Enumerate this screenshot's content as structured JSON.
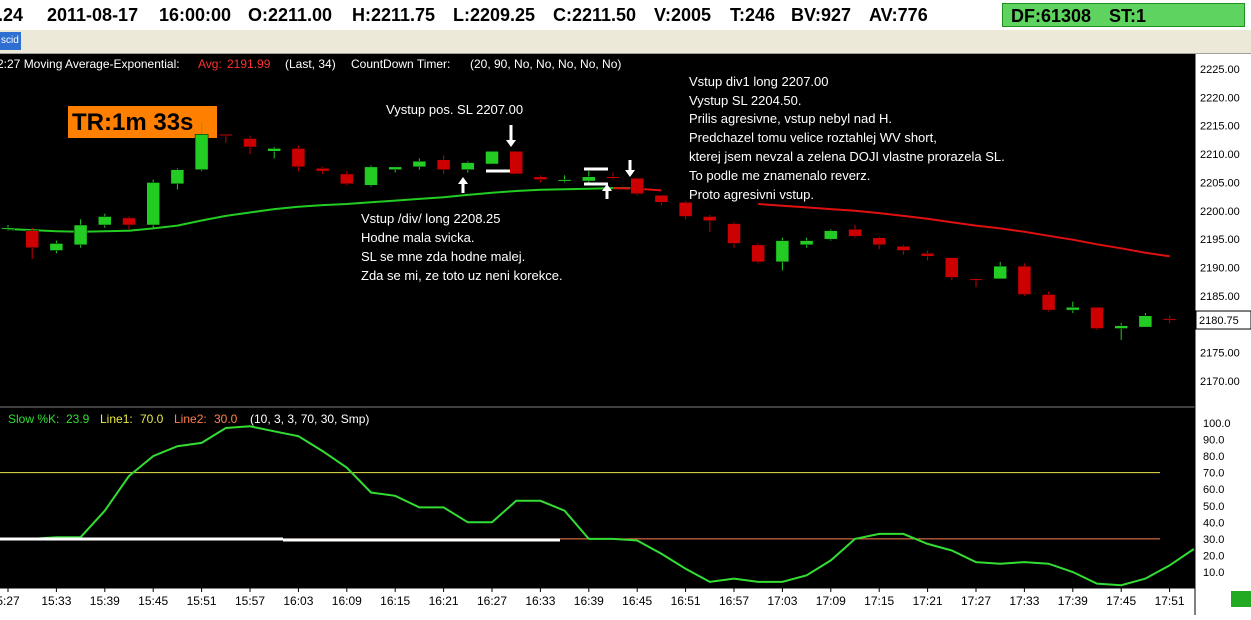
{
  "quote_bar": {
    "partial_field": ".24",
    "date": "2011-08-17",
    "time": "16:00:00",
    "open": "O:2211.00",
    "high": "H:2211.75",
    "low": "L:2209.25",
    "close": "C:2211.50",
    "volume": "V:2005",
    "ticks": "T:246",
    "bid_volume": "BV:927",
    "ask_volume": "AV:776",
    "df": "DF:61308",
    "st": "ST:1"
  },
  "tab": {
    "label": "scid"
  },
  "colors": {
    "bull": "#22cc22",
    "bear": "#cc0000",
    "ma": "#22cc22",
    "ma_bear": "#e01010",
    "stoch": "#33dd33",
    "line1": "#e8e84a",
    "line2": "#ff7f50",
    "background": "#000000",
    "timer_bg": "#ff7f00"
  },
  "price_header": {
    "prefix": "2:27 Moving Average-Exponential:",
    "avg_label": "Avg:",
    "avg_value": "2191.99",
    "params": "(Last, 34)",
    "countdown_label": "CountDown Timer:",
    "countdown_params": "(20, 90, No, No, No, No, No)"
  },
  "timer_badge": "TR:1m 33s",
  "annotations": {
    "exit_pos": "Vystup pos. SL 2207.00",
    "entry_div": [
      "Vstup /div/ long 2208.25",
      "Hodne mala svicka.",
      "SL se mne zda hodne malej.",
      "Zda se mi, ze toto uz neni korekce."
    ],
    "entry_div1": [
      "Vstup div1 long 2207.00",
      "Vystup SL 2204.50.",
      "Prilis agresivne, vstup nebyl nad H.",
      "Predchazel tomu velice roztahlej WV short,",
      "kterej jsem nevzal a zelena DOJI vlastne prorazela SL.",
      "To podle me znamenalo reverz.",
      "Proto agresivni vstup."
    ]
  },
  "stoch_header": {
    "k_label": "Slow %K:",
    "k_value": "23.9",
    "line1_label": "Line1:",
    "line1_value": "70.0",
    "line2_label": "Line2:",
    "line2_value": "30.0",
    "params": "(10, 3, 3, 70, 30, Smp)"
  },
  "chart_data": [
    {
      "type": "candlestick",
      "title": "",
      "ylim": [
        2167,
        2227
      ],
      "y_ticks": [
        "2225.00",
        "2220.00",
        "2215.00",
        "2210.00",
        "2205.00",
        "2200.00",
        "2195.00",
        "2190.00",
        "2185.00",
        "2180.00",
        "2175.00",
        "2170.00"
      ],
      "last_price_label": "2180.75",
      "candles": [
        {
          "o": 2197.0,
          "h": 2197.5,
          "l": 2196.5,
          "c": 2197.0
        },
        {
          "o": 2196.5,
          "h": 2197.0,
          "l": 2191.5,
          "c": 2193.5
        },
        {
          "o": 2193.0,
          "h": 2194.75,
          "l": 2192.5,
          "c": 2194.25
        },
        {
          "o": 2194.0,
          "h": 2198.5,
          "l": 2193.5,
          "c": 2197.5
        },
        {
          "o": 2197.5,
          "h": 2199.5,
          "l": 2197.0,
          "c": 2199.0
        },
        {
          "o": 2198.75,
          "h": 2199.0,
          "l": 2196.75,
          "c": 2197.5
        },
        {
          "o": 2197.5,
          "h": 2205.5,
          "l": 2196.75,
          "c": 2205.0
        },
        {
          "o": 2204.75,
          "h": 2207.5,
          "l": 2203.75,
          "c": 2207.25
        },
        {
          "o": 2207.25,
          "h": 2215.5,
          "l": 2207.0,
          "c": 2213.5
        },
        {
          "o": 2213.5,
          "h": 2213.5,
          "l": 2212.0,
          "c": 2213.25
        },
        {
          "o": 2212.75,
          "h": 2213.25,
          "l": 2210.0,
          "c": 2211.25
        },
        {
          "o": 2210.5,
          "h": 2211.25,
          "l": 2209.25,
          "c": 2211.0
        },
        {
          "o": 2211.0,
          "h": 2211.5,
          "l": 2207.0,
          "c": 2207.75
        },
        {
          "o": 2207.5,
          "h": 2207.75,
          "l": 2206.5,
          "c": 2207.0
        },
        {
          "o": 2206.5,
          "h": 2207.0,
          "l": 2204.5,
          "c": 2204.75
        },
        {
          "o": 2204.5,
          "h": 2208.0,
          "l": 2204.25,
          "c": 2207.75
        },
        {
          "o": 2207.25,
          "h": 2207.75,
          "l": 2206.75,
          "c": 2207.75
        },
        {
          "o": 2207.75,
          "h": 2209.25,
          "l": 2207.25,
          "c": 2208.75
        },
        {
          "o": 2209.0,
          "h": 2209.75,
          "l": 2206.5,
          "c": 2207.25
        },
        {
          "o": 2207.25,
          "h": 2208.75,
          "l": 2206.75,
          "c": 2208.5
        },
        {
          "o": 2208.25,
          "h": 2210.5,
          "l": 2208.25,
          "c": 2210.5
        },
        {
          "o": 2210.5,
          "h": 2210.5,
          "l": 2206.5,
          "c": 2206.5
        },
        {
          "o": 2206.0,
          "h": 2206.25,
          "l": 2205.0,
          "c": 2205.5
        },
        {
          "o": 2205.5,
          "h": 2206.25,
          "l": 2205.0,
          "c": 2205.5
        },
        {
          "o": 2205.25,
          "h": 2207.0,
          "l": 2204.5,
          "c": 2206.0
        },
        {
          "o": 2206.0,
          "h": 2206.75,
          "l": 2205.5,
          "c": 2205.75
        },
        {
          "o": 2205.75,
          "h": 2205.75,
          "l": 2202.75,
          "c": 2203.0
        },
        {
          "o": 2202.75,
          "h": 2202.75,
          "l": 2201.0,
          "c": 2201.5
        },
        {
          "o": 2201.5,
          "h": 2201.75,
          "l": 2198.5,
          "c": 2199.0
        },
        {
          "o": 2199.0,
          "h": 2199.25,
          "l": 2196.25,
          "c": 2198.25
        },
        {
          "o": 2197.75,
          "h": 2198.0,
          "l": 2193.5,
          "c": 2194.25
        },
        {
          "o": 2194.0,
          "h": 2194.25,
          "l": 2190.75,
          "c": 2191.0
        },
        {
          "o": 2191.0,
          "h": 2195.25,
          "l": 2189.5,
          "c": 2194.75
        },
        {
          "o": 2194.0,
          "h": 2195.25,
          "l": 2193.5,
          "c": 2194.75
        },
        {
          "o": 2195.0,
          "h": 2196.75,
          "l": 2194.75,
          "c": 2196.5
        },
        {
          "o": 2196.75,
          "h": 2197.5,
          "l": 2195.25,
          "c": 2195.5
        },
        {
          "o": 2195.25,
          "h": 2195.5,
          "l": 2193.25,
          "c": 2194.0
        },
        {
          "o": 2193.75,
          "h": 2194.0,
          "l": 2192.25,
          "c": 2193.0
        },
        {
          "o": 2192.5,
          "h": 2193.0,
          "l": 2191.25,
          "c": 2192.0
        },
        {
          "o": 2191.75,
          "h": 2191.75,
          "l": 2187.75,
          "c": 2188.25
        },
        {
          "o": 2188.0,
          "h": 2188.0,
          "l": 2186.5,
          "c": 2187.75
        },
        {
          "o": 2188.0,
          "h": 2191.0,
          "l": 2188.0,
          "c": 2190.25
        },
        {
          "o": 2190.25,
          "h": 2190.75,
          "l": 2185.0,
          "c": 2185.25
        },
        {
          "o": 2185.25,
          "h": 2185.75,
          "l": 2182.25,
          "c": 2182.5
        },
        {
          "o": 2182.5,
          "h": 2184.0,
          "l": 2182.0,
          "c": 2183.0
        },
        {
          "o": 2183.0,
          "h": 2183.0,
          "l": 2179.0,
          "c": 2179.25
        },
        {
          "o": 2179.25,
          "h": 2180.25,
          "l": 2177.25,
          "c": 2179.75
        },
        {
          "o": 2179.5,
          "h": 2182.0,
          "l": 2179.5,
          "c": 2181.5
        },
        {
          "o": 2181.0,
          "h": 2181.5,
          "l": 2180.25,
          "c": 2180.75
        }
      ],
      "ma_series": [
        {
          "color": "ma",
          "values": [
            2196.8,
            2196.6,
            2196.4,
            2196.3,
            2196.4,
            2196.5,
            2196.9,
            2197.4,
            2198.3,
            2199.1,
            2199.7,
            2200.3,
            2200.7,
            2201.0,
            2201.2,
            2201.5,
            2201.8,
            2202.1,
            2202.4,
            2202.8,
            2203.2,
            2203.5,
            2203.7,
            2203.8,
            2203.9,
            2204.0,
            2204.0,
            null,
            null,
            null,
            null,
            null,
            null,
            null,
            null,
            null,
            null,
            null,
            null,
            null,
            null,
            null,
            null,
            null,
            null,
            null,
            null,
            null,
            null
          ]
        },
        {
          "color": "ma_bear",
          "values": [
            null,
            null,
            null,
            null,
            null,
            null,
            null,
            null,
            null,
            null,
            null,
            null,
            null,
            null,
            null,
            null,
            null,
            null,
            null,
            null,
            null,
            null,
            null,
            null,
            null,
            2204.0,
            2203.9,
            2203.6,
            null,
            null,
            null,
            2201.2,
            2200.9,
            2200.6,
            2200.3,
            2200.0,
            2199.6,
            2199.1,
            2198.6,
            2198.0,
            2197.4,
            2196.9,
            2196.3,
            2195.6,
            2194.9,
            2194.1,
            2193.4,
            2192.6,
            2191.99
          ]
        }
      ]
    },
    {
      "type": "line",
      "title": "",
      "ylim": [
        0,
        105
      ],
      "y_ticks": [
        "100.0",
        "90.0",
        "80.0",
        "70.0",
        "60.0",
        "50.0",
        "40.0",
        "30.0",
        "20.0",
        "10.0"
      ],
      "x_tick_labels": [
        "5:27",
        "15:33",
        "15:39",
        "15:45",
        "15:51",
        "15:57",
        "16:03",
        "16:09",
        "16:15",
        "16:21",
        "16:27",
        "16:33",
        "16:39",
        "16:45",
        "16:51",
        "16:57",
        "17:03",
        "17:09",
        "17:15",
        "17:21",
        "17:27",
        "17:33",
        "17:39",
        "17:45",
        "17:51"
      ],
      "series": [
        {
          "values": [
            30,
            30,
            31,
            31,
            47,
            68,
            80,
            86,
            88,
            97,
            98,
            95,
            92,
            83,
            73,
            58,
            56,
            49,
            49,
            40,
            40,
            53,
            53,
            47,
            30,
            30,
            29,
            21,
            12,
            4,
            6,
            4,
            4,
            8,
            17,
            30,
            33,
            33,
            27,
            23,
            16,
            15,
            16,
            15,
            10,
            3,
            2,
            6,
            14,
            23.9
          ]
        }
      ],
      "levels": [
        70,
        30
      ]
    }
  ]
}
